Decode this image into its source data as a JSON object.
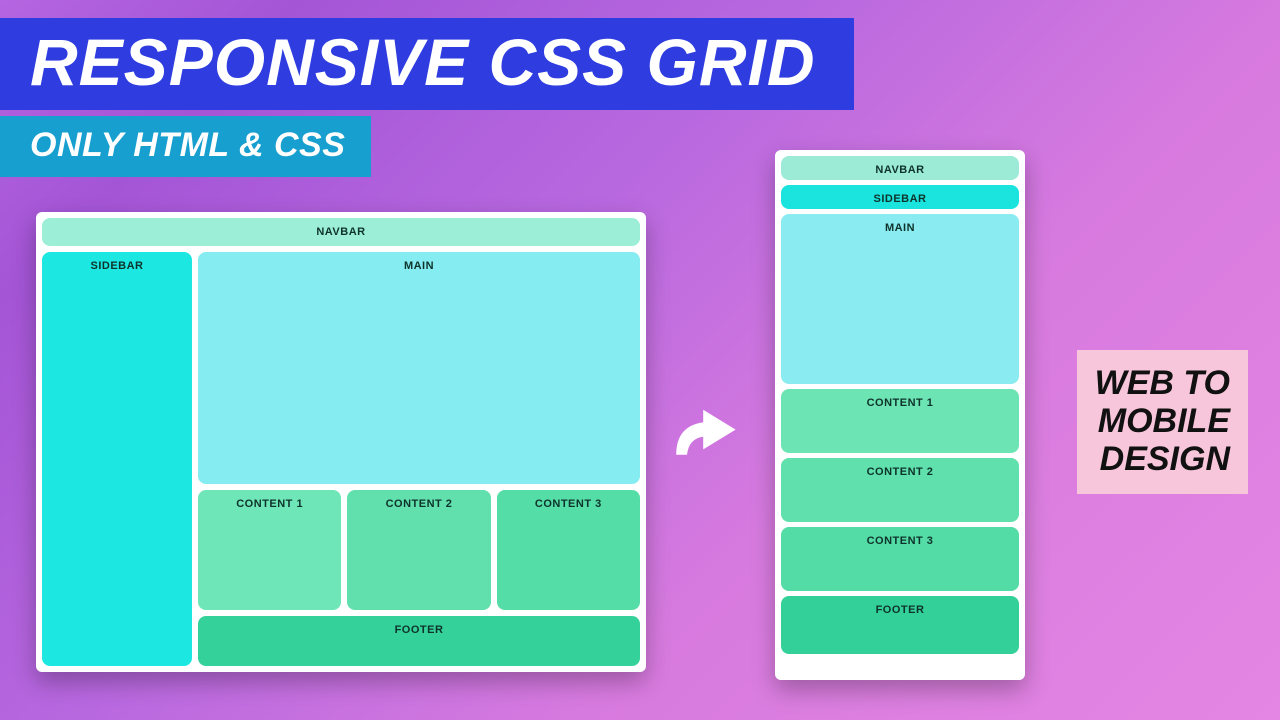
{
  "title": "RESPONSIVE CSS GRID",
  "subtitle": "ONLY HTML & CSS",
  "aside_lines": [
    "WEB TO",
    "MOBILE",
    "DESIGN"
  ],
  "layout": {
    "navbar": "NAVBAR",
    "sidebar": "SIDEBAR",
    "main": "MAIN",
    "content1": "CONTENT 1",
    "content2": "CONTENT 2",
    "content3": "CONTENT 3",
    "footer": "FOOTER"
  },
  "colors": {
    "title_bg": "#2f3de0",
    "subtitle_bg": "#179fcf",
    "aside_bg": "#f8c6db",
    "arrow": "#ffffff"
  }
}
